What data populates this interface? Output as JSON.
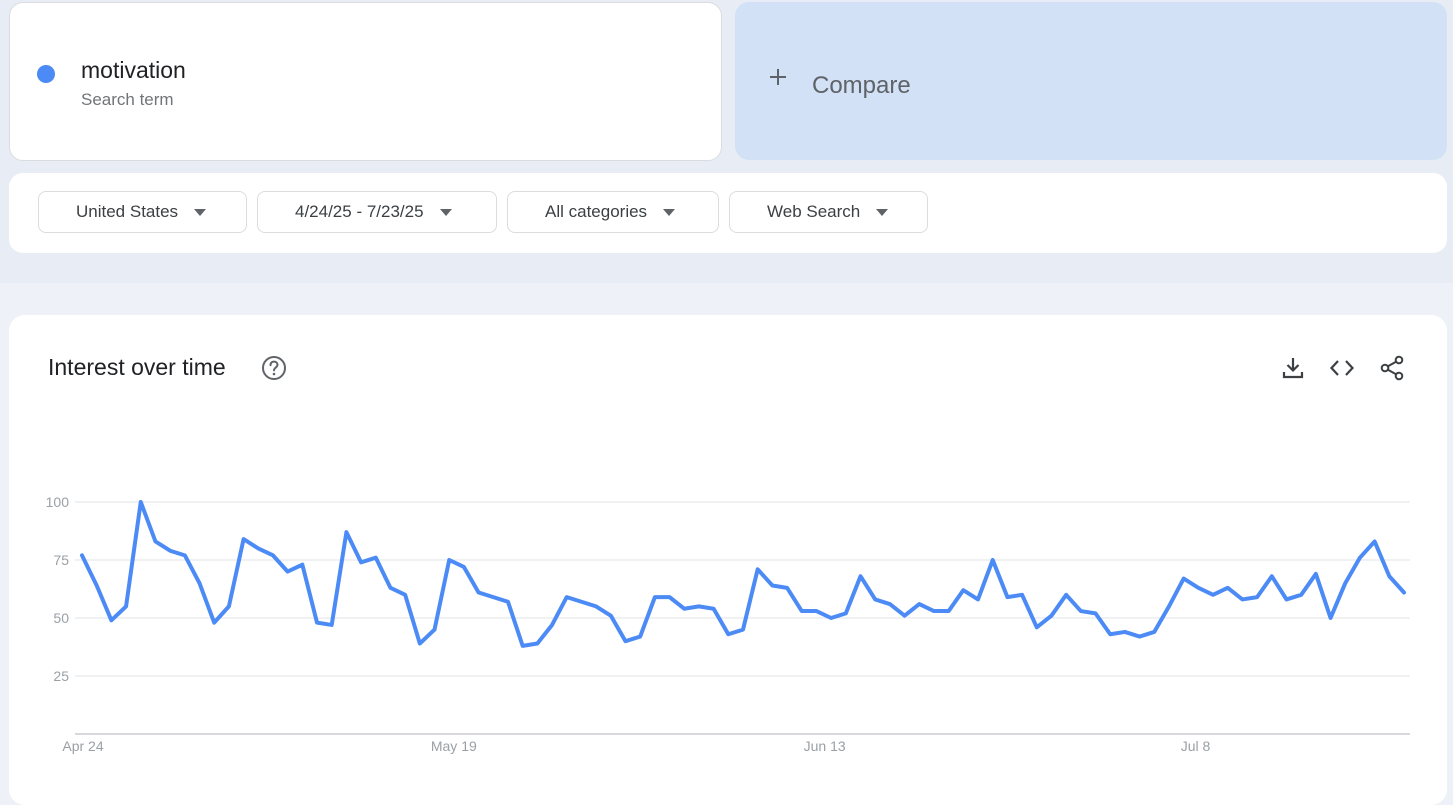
{
  "term": {
    "name": "motivation",
    "sub": "Search term",
    "color": "#4c8bf5"
  },
  "compare": {
    "label": "Compare",
    "icon": "plus-icon"
  },
  "filters": [
    {
      "label": "United States"
    },
    {
      "label": "4/24/25 - 7/23/25"
    },
    {
      "label": "All categories"
    },
    {
      "label": "Web Search"
    }
  ],
  "chart_section": {
    "title": "Interest over time",
    "icons": [
      "help-icon",
      "download-icon",
      "embed-icon",
      "share-icon"
    ]
  },
  "chart_data": {
    "type": "line",
    "title": "Interest over time",
    "xlabel": "",
    "ylabel": "",
    "ylim": [
      0,
      100
    ],
    "yticks": [
      25,
      50,
      75,
      100
    ],
    "grid": true,
    "x_start": "2025-04-24",
    "x_end": "2025-07-23",
    "x_tick_labels": [
      {
        "label": "Apr 24",
        "date": "2025-04-24"
      },
      {
        "label": "May 19",
        "date": "2025-05-19"
      },
      {
        "label": "Jun 13",
        "date": "2025-06-13"
      },
      {
        "label": "Jul 8",
        "date": "2025-07-08"
      }
    ],
    "series": [
      {
        "color": "#4c8bf5",
        "values": [
          77,
          64,
          49,
          55,
          100,
          83,
          79,
          77,
          65,
          48,
          55,
          84,
          80,
          77,
          70,
          73,
          48,
          47,
          87,
          74,
          76,
          63,
          60,
          39,
          45,
          75,
          72,
          61,
          59,
          57,
          38,
          39,
          47,
          59,
          57,
          55,
          51,
          40,
          42,
          59,
          59,
          54,
          55,
          54,
          43,
          45,
          71,
          64,
          63,
          53,
          53,
          50,
          52,
          68,
          58,
          56,
          51,
          56,
          53,
          53,
          62,
          58,
          75,
          59,
          60,
          46,
          51,
          60,
          53,
          52,
          43,
          44,
          42,
          44,
          55,
          67,
          63,
          60,
          63,
          58,
          59,
          68,
          58,
          60,
          69,
          50,
          65,
          76,
          83,
          68,
          61
        ]
      }
    ]
  }
}
